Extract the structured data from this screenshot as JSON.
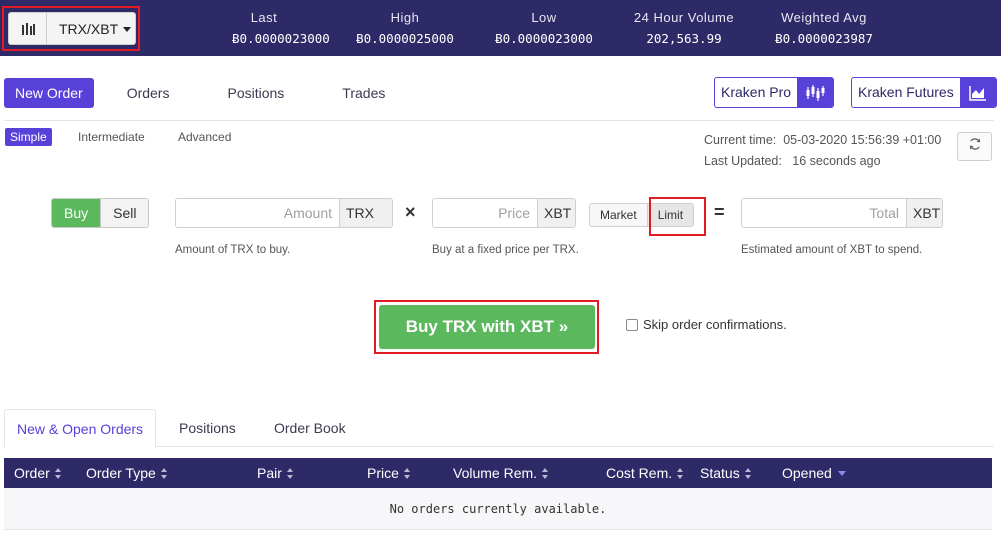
{
  "ticker": {
    "pair": "TRX/XBT",
    "stats": [
      {
        "label": "Last",
        "value": "Ƀ0.0000023000"
      },
      {
        "label": "High",
        "value": "Ƀ0.0000025000"
      },
      {
        "label": "Low",
        "value": "Ƀ0.0000023000"
      },
      {
        "label": "24 Hour Volume",
        "value": "202,563.99"
      },
      {
        "label": "Weighted Avg",
        "value": "Ƀ0.0000023987"
      }
    ]
  },
  "nav": {
    "items": [
      "New Order",
      "Orders",
      "Positions",
      "Trades"
    ],
    "kraken_pro": "Kraken Pro",
    "kraken_futures": "Kraken Futures"
  },
  "modes": [
    "Simple",
    "Intermediate",
    "Advanced"
  ],
  "time": {
    "current_label": "Current time:",
    "current_value": "05-03-2020 15:56:39 +01:00",
    "updated_label": "Last Updated:",
    "updated_value": "16 seconds ago"
  },
  "form": {
    "buy": "Buy",
    "sell": "Sell",
    "amount_placeholder": "Amount",
    "amount_currency": "TRX",
    "amount_hint": "Amount of TRX to buy.",
    "times": "×",
    "price_placeholder": "Price",
    "price_currency": "XBT",
    "price_hint": "Buy at a fixed price per TRX.",
    "market": "Market",
    "limit": "Limit",
    "equals": "=",
    "total_placeholder": "Total",
    "total_currency": "XBT",
    "total_hint": "Estimated amount of XBT to spend.",
    "submit": "Buy TRX with XBT »",
    "skip_label": "Skip order confirmations."
  },
  "bottom_tabs": [
    "New & Open Orders",
    "Positions",
    "Order Book"
  ],
  "table": {
    "columns": [
      "Order",
      "Order Type",
      "Pair",
      "Price",
      "Volume Rem.",
      "Cost Rem.",
      "Status",
      "Opened"
    ],
    "empty": "No orders currently available."
  },
  "colors": {
    "header_bg": "#2e2967",
    "accent": "#5741d9",
    "buy_green": "#5cb85c",
    "highlight": "#e01b24"
  }
}
